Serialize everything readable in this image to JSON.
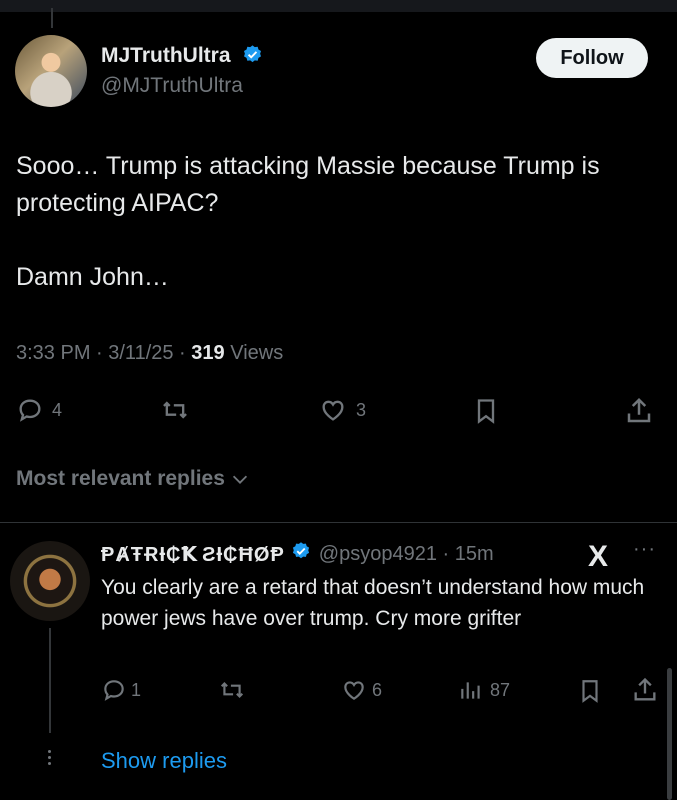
{
  "tweet": {
    "author_name": "MJTruthUltra",
    "author_handle": "@MJTruthUltra",
    "follow_label": "Follow",
    "text_line1": "Sooo… Trump is attacking Massie because Trump is protecting AIPAC?",
    "text_line2": "Damn John…",
    "timestamp": "3:33 PM · 3/11/25 · ",
    "views_count": "319",
    "views_label": " Views",
    "replies": "4",
    "likes": "3"
  },
  "replies_sort": {
    "label": "Most relevant replies"
  },
  "reply": {
    "author_name": "ⱣȺŦɌƗ₵Ꝁ ƧƗ₵ĦØⱣ",
    "author_handle": "@psyop4921 · 15m",
    "text": "You clearly are a retard that doesn’t understand how much power jews have over trump. Cry more grifter",
    "replies": "1",
    "likes": "6",
    "views": "87",
    "x_logo": "X",
    "more": "···"
  },
  "show_replies": "Show replies",
  "icons": [
    "verified-badge-icon",
    "reply-icon",
    "retweet-icon",
    "like-icon",
    "bookmark-icon",
    "share-icon",
    "views-icon",
    "chevron-down-icon",
    "x-logo-icon",
    "more-icon"
  ],
  "colors": {
    "background": "#000000",
    "text": "#e7e9ea",
    "muted": "#71767b",
    "accent": "#1d9bf0"
  }
}
